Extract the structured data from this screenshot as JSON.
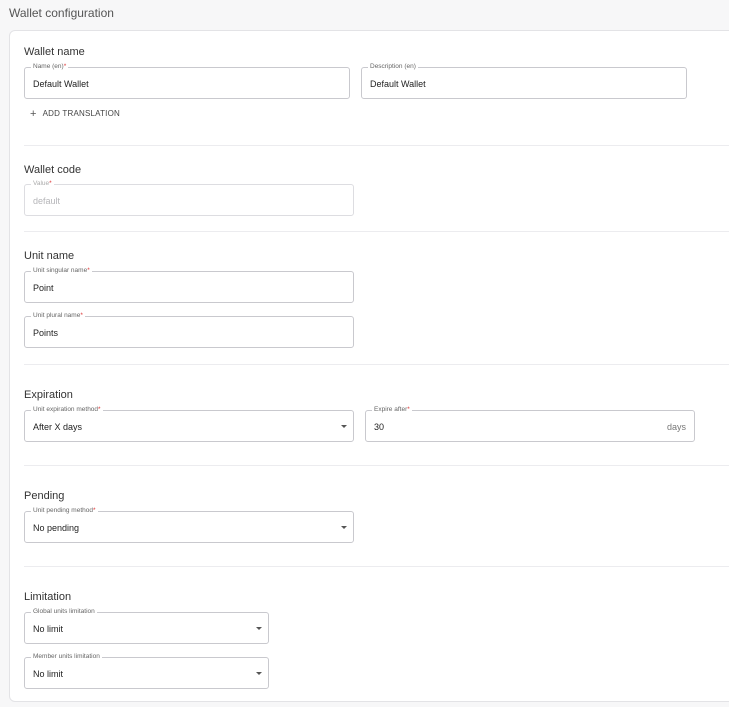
{
  "page": {
    "title": "Wallet configuration"
  },
  "wallet_name": {
    "title": "Wallet name",
    "name_label": "Name (en)",
    "name_required": "*",
    "name_value": "Default Wallet",
    "description_label": "Description (en)",
    "description_value": "Default Wallet",
    "add_translation": "ADD TRANSLATION",
    "add_icon": "+"
  },
  "wallet_code": {
    "title": "Wallet code",
    "value_label": "Value",
    "value_required": "*",
    "value": "default"
  },
  "unit_name": {
    "title": "Unit name",
    "singular_label": "Unit singular name",
    "singular_required": "*",
    "singular_value": "Point",
    "plural_label": "Unit plural name",
    "plural_required": "*",
    "plural_value": "Points"
  },
  "expiration": {
    "title": "Expiration",
    "method_label": "Unit expiration method",
    "method_required": "*",
    "method_value": "After X days",
    "expire_label": "Expire after",
    "expire_required": "*",
    "expire_value": "30",
    "expire_suffix": "days"
  },
  "pending": {
    "title": "Pending",
    "method_label": "Unit pending method",
    "method_required": "*",
    "method_value": "No pending"
  },
  "limitation": {
    "title": "Limitation",
    "global_label": "Global units limitation",
    "global_value": "No limit",
    "member_label": "Member units limitation",
    "member_value": "No limit"
  }
}
